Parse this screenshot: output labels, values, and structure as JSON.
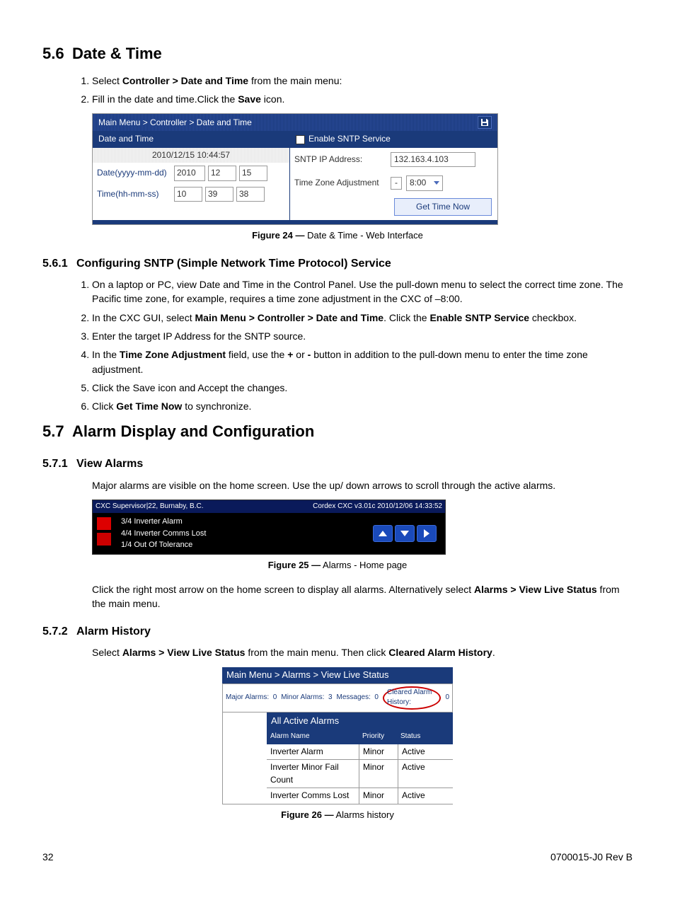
{
  "s56": {
    "num": "5.6",
    "title": "Date & Time",
    "li1": {
      "pre": "Select ",
      "b": "Controller > Date and Time",
      "post": " from the main menu:"
    },
    "li2": {
      "pre": "Fill in the date and time.Click the ",
      "b": "Save",
      "post": " icon."
    }
  },
  "fig24": {
    "cap_b": "Figure 24  —",
    "cap": "  Date & Time - Web Interface",
    "bc": "Main Menu > Controller > Date and Time",
    "dt_title": "Date and Time",
    "sntp_title": "Enable SNTP Service",
    "stamp": "2010/12/15 10:44:57",
    "date_lbl": "Date(yyyy-mm-dd)",
    "y": "2010",
    "m": "12",
    "d": "15",
    "time_lbl": "Time(hh-mm-ss)",
    "h": "10",
    "mi": "39",
    "s": "38",
    "ip_lbl": "SNTP IP Address:",
    "ip": "132.163.4.103",
    "tz_lbl": "Time Zone Adjustment",
    "sign": "-",
    "tz": "8:00",
    "get": "Get Time Now"
  },
  "s561": {
    "num": "5.6.1",
    "title": "Configuring SNTP (Simple Network Time Protocol) Service",
    "li1": "On a laptop or PC, view Date and Time in the Control Panel. Use the pull-down menu to select the correct time zone. The Pacific time zone, for example, requires a time zone adjustment in the CXC of –8:00.",
    "li2": {
      "a": "In the CXC GUI, select ",
      "b": "Main Menu > Controller > Date and Time",
      "c": ". Click the ",
      "d": "Enable SNTP Service",
      "e": " checkbox."
    },
    "li3": "Enter the target IP Address for the SNTP source.",
    "li4": {
      "a": "In the ",
      "b": "Time Zone Adjustment",
      "c": " field, use the ",
      "d": "+",
      "e": " or ",
      "f": "-",
      "g": " button in addition to the pull-down menu to enter the time zone adjustment."
    },
    "li5": "Click the Save icon and Accept the changes.",
    "li6": {
      "a": "Click ",
      "b": "Get Time Now",
      "c": " to synchronize."
    }
  },
  "s57": {
    "num": "5.7",
    "title": "Alarm Display and Configuration"
  },
  "s571": {
    "num": "5.7.1",
    "title": "View Alarms",
    "p1": "Major alarms are visible on the home screen. Use the up/ down arrows to scroll through the active alarms.",
    "p2": {
      "a": "Click the right most arrow on the home screen to display all alarms. Alternatively select ",
      "b": "Alarms > View Live Status",
      "c": " from the main menu."
    }
  },
  "fig25": {
    "cap_b": "Figure 25  —",
    "cap": "  Alarms - Home page",
    "hl": "CXC Supervisor|22, Burnaby, B.C.",
    "hr": "Cordex CXC v3.01c 2010/12/06 14:33:52",
    "a1": "3/4 Inverter Alarm",
    "a2": "4/4 Inverter Comms Lost",
    "a3": "1/4 Out Of Tolerance"
  },
  "s572": {
    "num": "5.7.2",
    "title": "Alarm History",
    "p": {
      "a": "Select ",
      "b": "Alarms > View Live Status",
      "c": " from the main menu. Then click ",
      "d": "Cleared Alarm History",
      "e": "."
    }
  },
  "fig26": {
    "cap_b": "Figure 26  —",
    "cap": "  Alarms history",
    "bc": "Main Menu > Alarms > View Live Status",
    "maj": "Major Alarms:",
    "majv": "0",
    "min": "Minor Alarms:",
    "minv": "3",
    "msg": "Messages:",
    "msgv": "0",
    "clr": "Cleared Alarm History:",
    "clrv": "0",
    "th": "All Active Alarms",
    "c1": "Alarm Name",
    "c2": "Priority",
    "c3": "Status",
    "rows": [
      {
        "n": "Inverter Alarm",
        "p": "Minor",
        "s": "Active"
      },
      {
        "n": "Inverter Minor Fail Count",
        "p": "Minor",
        "s": "Active"
      },
      {
        "n": "Inverter Comms Lost",
        "p": "Minor",
        "s": "Active"
      }
    ]
  },
  "foot": {
    "pg": "32",
    "doc": "0700015-J0    Rev B"
  }
}
